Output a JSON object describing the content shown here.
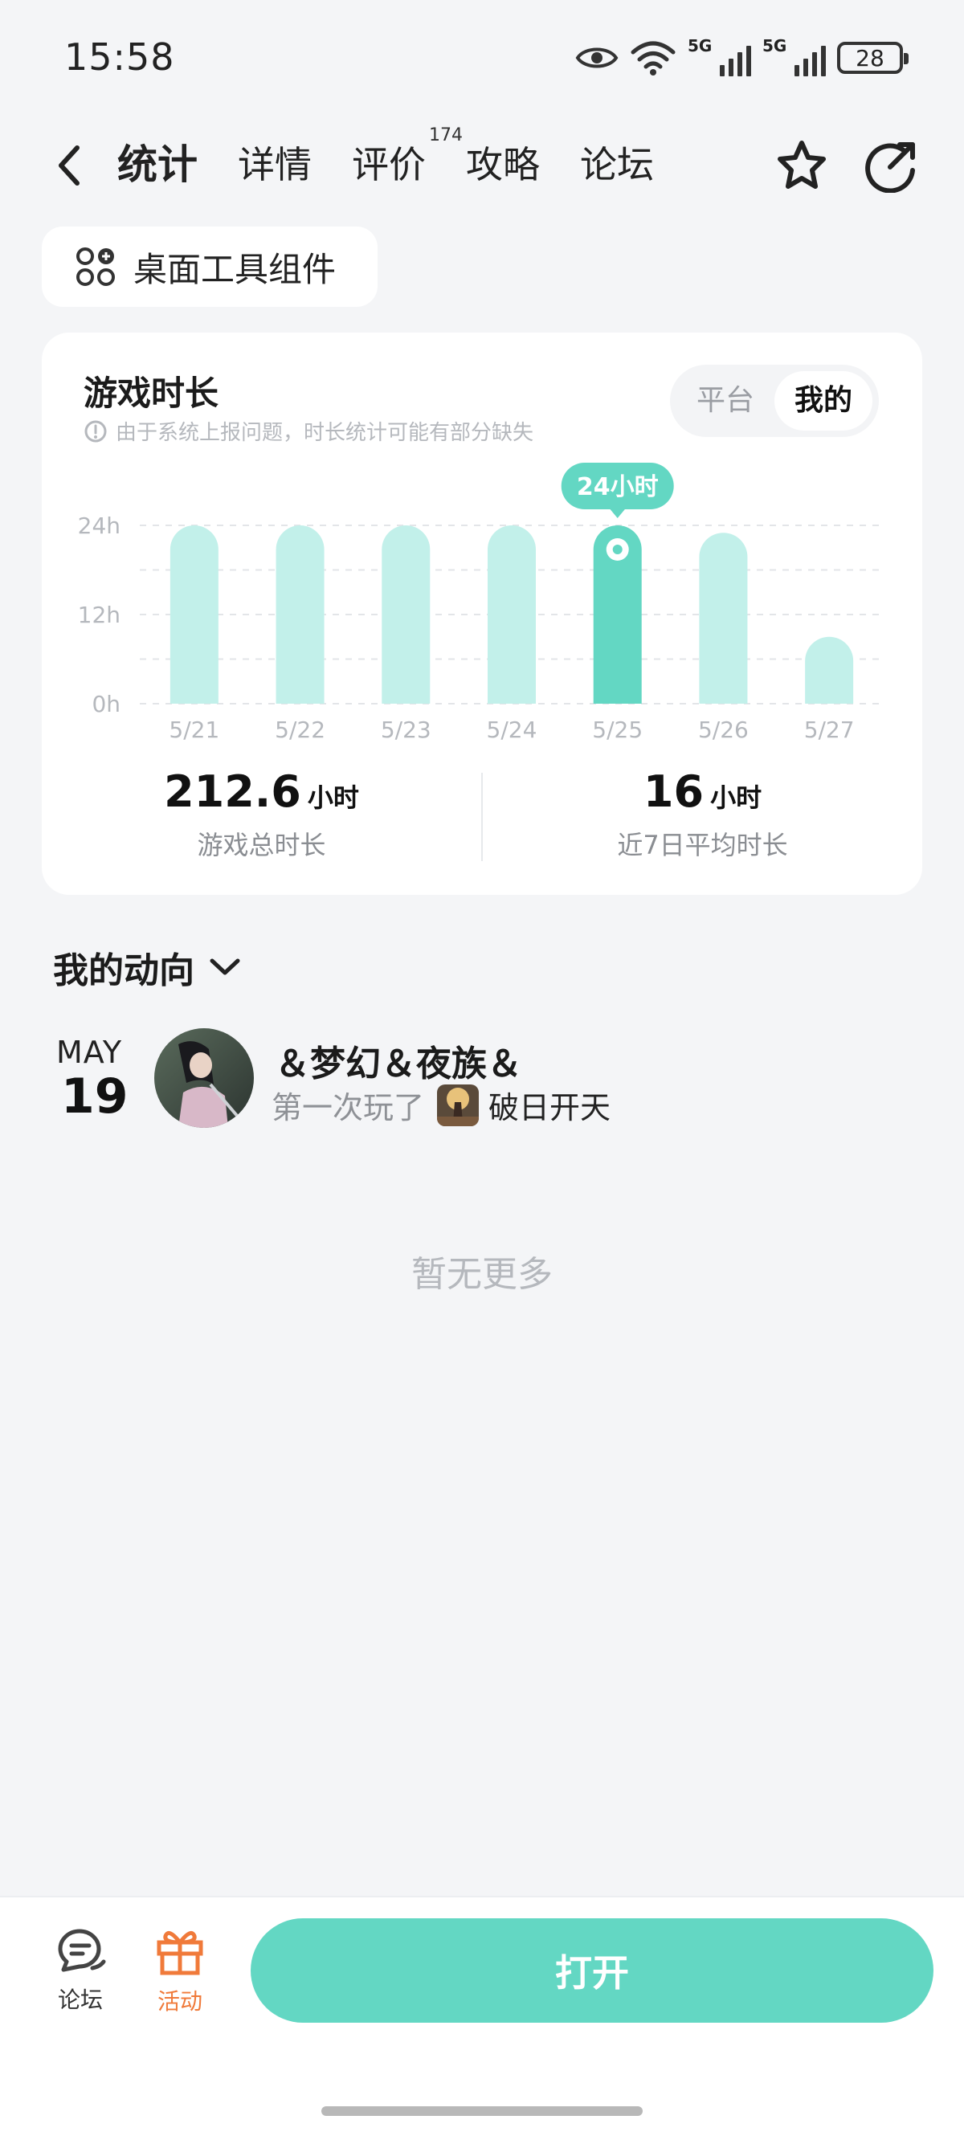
{
  "status_bar": {
    "time": "15:58",
    "network_1": "5G",
    "network_2": "5G",
    "battery": "28"
  },
  "nav": {
    "tabs": [
      {
        "label": "统计",
        "active": true
      },
      {
        "label": "详情"
      },
      {
        "label": "评价",
        "count": "174"
      },
      {
        "label": "攻略"
      },
      {
        "label": "论坛"
      }
    ]
  },
  "widget_chip": {
    "label": "桌面工具组件"
  },
  "playtime_card": {
    "title": "游戏时长",
    "note": "由于系统上报问题，时长统计可能有部分缺失",
    "segment": {
      "options": [
        "平台",
        "我的"
      ],
      "selected": "我的"
    },
    "tooltip": "24小时",
    "total": {
      "value": "212.6",
      "unit": "小时",
      "label": "游戏总时长"
    },
    "average": {
      "value": "16",
      "unit": "小时",
      "label": "近7日平均时长"
    }
  },
  "chart_data": {
    "type": "bar",
    "categories": [
      "5/21",
      "5/22",
      "5/23",
      "5/24",
      "5/25",
      "5/26",
      "5/27"
    ],
    "values": [
      24,
      24,
      24,
      24,
      24,
      23,
      9
    ],
    "highlight_index": 4,
    "y_ticks": [
      "0h",
      "12h",
      "24h"
    ],
    "ylim": [
      0,
      24
    ],
    "bar_color": "#c2f0ea",
    "highlight_color": "#63d7c3",
    "grid": true
  },
  "activity": {
    "header": "我的动向",
    "items": [
      {
        "month": "MAY",
        "day": "19",
        "user": "＆梦幻＆夜族＆",
        "action": "第一次玩了",
        "game": "破日开天"
      }
    ],
    "no_more": "暂无更多"
  },
  "bottom_bar": {
    "forum_label": "论坛",
    "activity_label": "活动",
    "open_label": "打开"
  }
}
